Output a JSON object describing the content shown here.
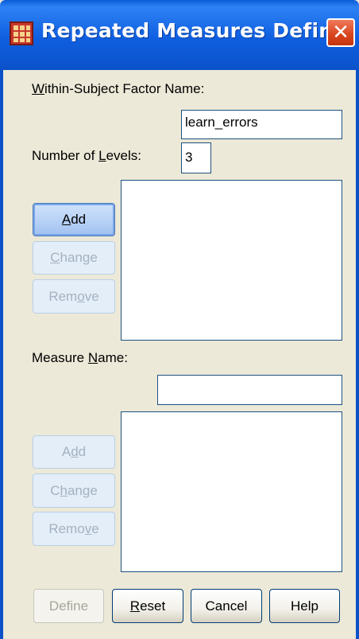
{
  "window": {
    "title": "Repeated Measures Defin...",
    "close_glyph": "✕",
    "icon": "spss-grid-icon",
    "title_bar_color": "#0B52C9"
  },
  "factor": {
    "name_label_mnemonic": "W",
    "name_label_rest": "ithin-Subject Factor Name:",
    "name_value": "learn_errors",
    "levels_label_pre": "Number of ",
    "levels_label_mnemonic": "L",
    "levels_label_post": "evels:",
    "levels_value": "3",
    "add_mnemonic": "A",
    "add_rest": "dd",
    "change_mnemonic": "C",
    "change_rest": "hange",
    "remove_pre": "Rem",
    "remove_mnemonic": "o",
    "remove_post": "ve"
  },
  "measure": {
    "name_label_pre": "Measure ",
    "name_label_mnemonic": "N",
    "name_label_post": "ame:",
    "name_value": "",
    "add_pre": "A",
    "add_mnemonic": "d",
    "add_post": "d",
    "change_pre": "C",
    "change_mnemonic": "h",
    "change_post": "ange",
    "remove_pre": "Remo",
    "remove_mnemonic": "v",
    "remove_post": "e"
  },
  "footer": {
    "define_label": "Define",
    "reset_mnemonic": "R",
    "reset_rest": "eset",
    "cancel_label": "Cancel",
    "help_label": "Help"
  }
}
